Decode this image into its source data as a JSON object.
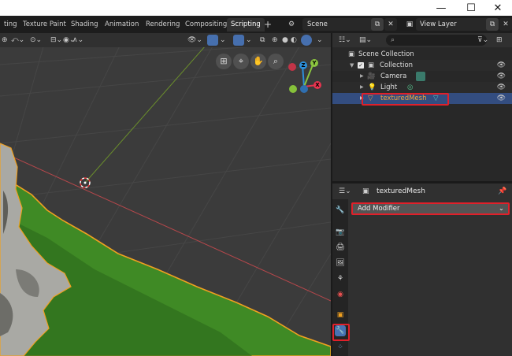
{
  "window": {
    "minimize": "—",
    "maximize": "☐",
    "close": "✕"
  },
  "workspaces": {
    "tabs": [
      {
        "label": "ting"
      },
      {
        "label": "Texture Paint"
      },
      {
        "label": "Shading"
      },
      {
        "label": "Animation"
      },
      {
        "label": "Rendering"
      },
      {
        "label": "Compositing"
      },
      {
        "label": "Scripting"
      }
    ],
    "add": "+"
  },
  "scene": {
    "label": "Scene"
  },
  "view_layer": {
    "label": "View Layer"
  },
  "outliner": {
    "search_placeholder": "⌕",
    "items": [
      {
        "label": "Scene Collection"
      },
      {
        "label": "Collection"
      },
      {
        "label": "Camera"
      },
      {
        "label": "Light"
      },
      {
        "label": "texturedMesh"
      }
    ]
  },
  "properties": {
    "object_name": "texturedMesh",
    "add_modifier": "Add Modifier"
  },
  "gizmo": {
    "z": "Z",
    "y": "Y",
    "x": "X"
  },
  "colors": {
    "accent": "#4772b3",
    "highlight": "#e0202a",
    "x_axis": "#e8344f",
    "y_axis": "#8bc53f",
    "z_axis": "#2c8fdb"
  }
}
